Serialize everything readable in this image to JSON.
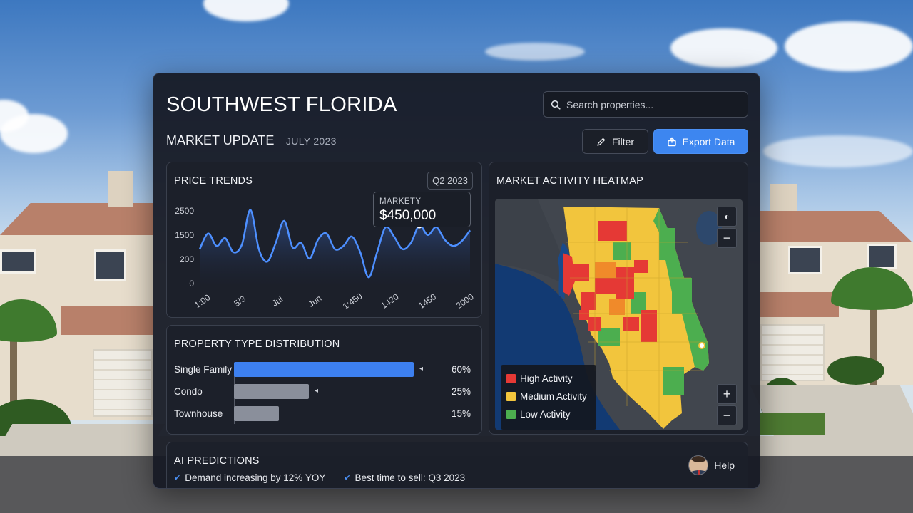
{
  "header": {
    "title": "SOUTHWEST FLORIDA",
    "subtitle": "MARKET UPDATE",
    "date": "JULY 2023"
  },
  "search": {
    "placeholder": "Search properties..."
  },
  "toolbar": {
    "filter_label": "Filter",
    "export_label": "Export Data",
    "accent_color": "#3d86f0"
  },
  "price_trends": {
    "title": "PRICE TRENDS",
    "badge": "Q2 2023",
    "tooltip_label": "MARKETY",
    "tooltip_value": "$450,000",
    "line_color": "#4d8fff"
  },
  "chart_data": {
    "type": "line",
    "title": "PRICE TRENDS",
    "y_ticks": [
      "2500",
      "1500",
      "200",
      "0"
    ],
    "x_ticks": [
      "1:00",
      "5/3",
      "Jul",
      "Jun",
      "1:450",
      "1420",
      "1450",
      "2000"
    ],
    "series": [
      {
        "values": [
          1100,
          1600,
          1200,
          1450,
          1000,
          1250,
          2350,
          1100,
          700,
          1300,
          2000,
          1150,
          1300,
          800,
          1400,
          1600,
          1100,
          1200,
          1500,
          1000,
          200,
          1000,
          1800,
          1500,
          1100,
          1300,
          1850,
          1550,
          1800,
          1400,
          1200,
          1350,
          1700
        ]
      }
    ],
    "highlight_index": 26
  },
  "property_distribution": {
    "title": "PROPERTY TYPE DISTRIBUTION",
    "rows": [
      {
        "label": "Single Family",
        "value": 60,
        "pct": "60%",
        "color": "#3d80f0",
        "caret": "◂"
      },
      {
        "label": "Condo",
        "value": 25,
        "pct": "25%",
        "color": "#8a8f9b",
        "caret": "◂"
      },
      {
        "label": "Townhouse",
        "value": 15,
        "pct": "15%",
        "color": "#8a8f9b",
        "caret": ""
      }
    ]
  },
  "heatmap": {
    "title": "MARKET ACTIVITY HEATMAP",
    "legend": [
      {
        "label": "High Activity",
        "color": "#e53935"
      },
      {
        "label": "Medium Activity",
        "color": "#f2c53d"
      },
      {
        "label": "Low Activity",
        "color": "#4cae4f"
      }
    ],
    "controls": {
      "zoom_in": "+",
      "zoom_out": "−",
      "locate": "◐"
    }
  },
  "ai_predictions": {
    "title": "AI PREDICTIONS",
    "items": [
      {
        "text": "Demand increasing by 12% YOY"
      },
      {
        "text": "Best time to sell: Q3 2023"
      }
    ],
    "help_label": "Help"
  }
}
